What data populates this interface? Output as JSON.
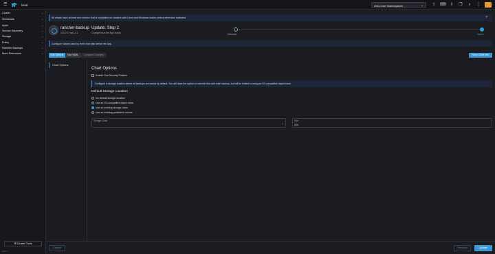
{
  "topbar": {
    "cluster_name": "local",
    "namespace_select": "Only User Namespaces",
    "icons": [
      "upload-icon",
      "terminal-icon",
      "download-icon",
      "copy-icon",
      "search-icon",
      "kebab-icon"
    ]
  },
  "sidebar": {
    "items": [
      {
        "label": "Cluster"
      },
      {
        "label": "Workloads"
      },
      {
        "label": "Apps"
      },
      {
        "label": "Service Discovery"
      },
      {
        "label": "Storage"
      },
      {
        "label": "Policy"
      },
      {
        "label": "Rancher Backups"
      },
      {
        "label": "More Resources"
      }
    ],
    "cluster_tools": "Cluster Tools",
    "version": "v2.7.x"
  },
  "banner": {
    "text": "All charts have at least one version that is installable on clusters with Linux and Windows nodes unless otherwise indicated."
  },
  "header": {
    "app_name": "rancher-backup",
    "app_version": "102.0.1+up3.1.1",
    "step_title": "Update: Step 2",
    "step_subtitle": "Change how the App works"
  },
  "steps": [
    {
      "label": "Metadata"
    },
    {
      "label": "Values"
    }
  ],
  "info_bar": {
    "text": "Configure Values used by Helm that help define the App."
  },
  "tabs": {
    "edit_options": "Edit Options",
    "edit_yaml": "Edit YAML",
    "compare_changes": "Compare Changes",
    "view_chart_info": "View Chart Info"
  },
  "nav": {
    "chart_options": "Chart Options"
  },
  "form": {
    "title": "Chart Options",
    "psp_checkbox": "Enable Pod Security Policies",
    "storage_info": "Configure a storage location where all backups are saved by default. You will have the option to override this with each backup, but will be limited to using an S3-compatible object store.",
    "section_title": "Default Storage Location",
    "options": [
      {
        "label": "No default storage location",
        "selected": false
      },
      {
        "label": "Use an S3-compatible object store",
        "selected": false
      },
      {
        "label": "Use an existing storage class",
        "selected": true
      },
      {
        "label": "Use an existing persistent volume",
        "selected": false
      }
    ],
    "storage_class_label": "Storage Class",
    "size_label": "Size",
    "size_value": "2Gi"
  },
  "footer": {
    "cancel": "Cancel",
    "previous": "Previous",
    "update": "Update"
  },
  "colors": {
    "accent": "#3d98d3",
    "background": "#1b1c21",
    "sidebar": "#17181d",
    "info_bg": "#1d2638"
  }
}
